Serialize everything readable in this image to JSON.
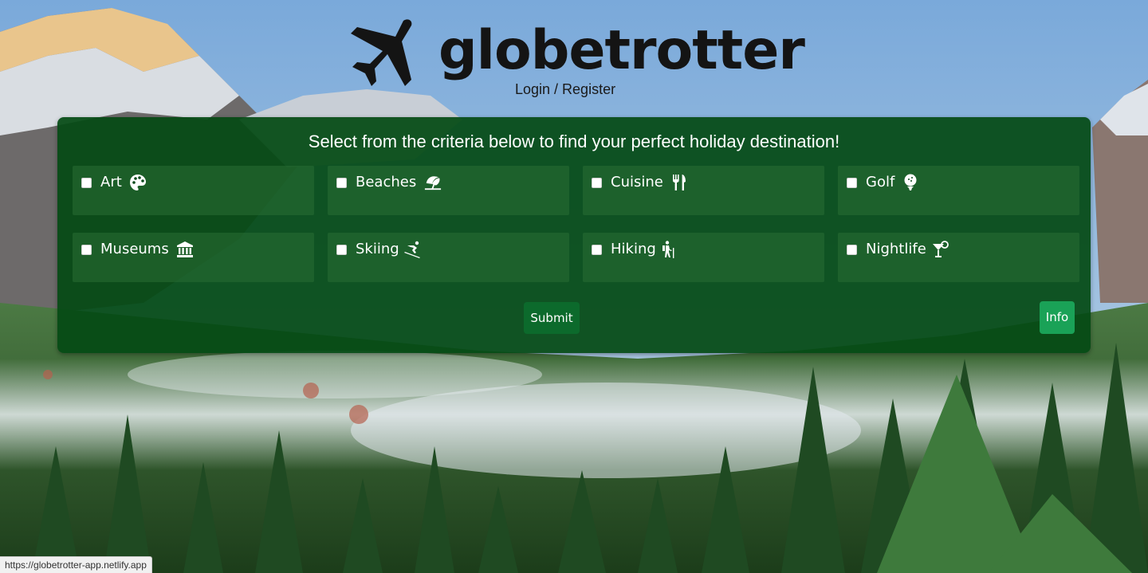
{
  "header": {
    "logo_text": "globetrotter",
    "login_link": "Login / Register"
  },
  "panel": {
    "heading": "Select from the criteria below to find your perfect holiday destination!",
    "options": [
      {
        "label": "Art",
        "icon": "palette-icon"
      },
      {
        "label": "Beaches",
        "icon": "umbrella-beach-icon"
      },
      {
        "label": "Cuisine",
        "icon": "utensils-icon"
      },
      {
        "label": "Golf",
        "icon": "golf-ball-icon"
      },
      {
        "label": "Museums",
        "icon": "landmark-icon"
      },
      {
        "label": "Skiing",
        "icon": "skiing-icon"
      },
      {
        "label": "Hiking",
        "icon": "hiking-icon"
      },
      {
        "label": "Nightlife",
        "icon": "cocktail-icon"
      }
    ],
    "submit_label": "Submit",
    "info_label": "Info"
  },
  "status_bar": {
    "url": "https://globetrotter-app.netlify.app"
  },
  "colors": {
    "panel_bg": "#044a14",
    "submit_bg": "#0c6a2c",
    "info_bg": "#1aa257",
    "logo_color": "#141414"
  }
}
